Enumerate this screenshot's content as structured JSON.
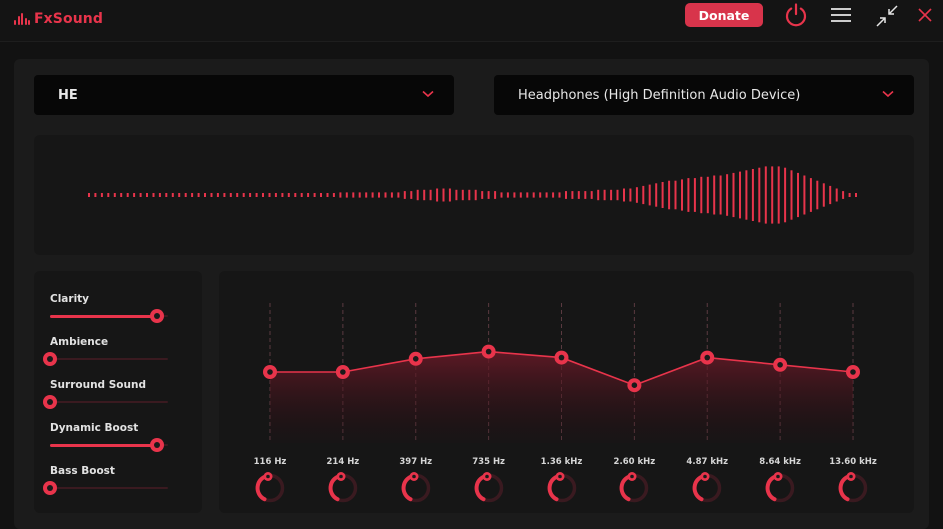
{
  "app": {
    "name": "FxSound",
    "donate_label": "Donate",
    "accent": "#e8344b"
  },
  "titlebar": {
    "icons": [
      "power-icon",
      "menu-icon",
      "minimize-arrows-icon",
      "close-icon"
    ]
  },
  "preset": {
    "selected": "HE"
  },
  "device": {
    "selected": "Headphones (High Definition Audio Device)"
  },
  "visualizer": {
    "bars": [
      1,
      1,
      1,
      1,
      1,
      1,
      1,
      1,
      1,
      1,
      1,
      1,
      1,
      1,
      1,
      1,
      1,
      1,
      1,
      1,
      1,
      1,
      1,
      1,
      1,
      1,
      1,
      1,
      1,
      1,
      1,
      1,
      1,
      1,
      1,
      1,
      1,
      1,
      1,
      1,
      1,
      1,
      1,
      1,
      1,
      1,
      1,
      1,
      1,
      1,
      1,
      1,
      1,
      1,
      1,
      1,
      1,
      1,
      1,
      1,
      1,
      1,
      1,
      1,
      1,
      1,
      1,
      1,
      1,
      1,
      1,
      1,
      1,
      1,
      1,
      1,
      1,
      1,
      2,
      2,
      2,
      2,
      2,
      2,
      2,
      2,
      2,
      2,
      2,
      2,
      2,
      2,
      2,
      2,
      2,
      2,
      2,
      3,
      3,
      3,
      3,
      4,
      4,
      4,
      4,
      4,
      4,
      4,
      5,
      5,
      5,
      5,
      5,
      5,
      4,
      4,
      4,
      4,
      4,
      4,
      4,
      3,
      3,
      3,
      3,
      3,
      3,
      3,
      2,
      2,
      2,
      2,
      2,
      2,
      2,
      2,
      2,
      2,
      2,
      2,
      2,
      2,
      2,
      2,
      2,
      2,
      2,
      2,
      3,
      3,
      3,
      3,
      3,
      3,
      3,
      3,
      3,
      3,
      4,
      4,
      4,
      4,
      4,
      4,
      4,
      4,
      5,
      5,
      5,
      6,
      6,
      6,
      7,
      7,
      8,
      8,
      9,
      9,
      10,
      10,
      11,
      11,
      11,
      12,
      12,
      12,
      13,
      13,
      13,
      13,
      14,
      14,
      14,
      15,
      15,
      15,
      15,
      16,
      16,
      16,
      17,
      17,
      18,
      18,
      19,
      19,
      20,
      20,
      21,
      21,
      22,
      22,
      22,
      22,
      22,
      22,
      21,
      20,
      19,
      18,
      17,
      16,
      15,
      14,
      13,
      12,
      11,
      10,
      9,
      8,
      7,
      6,
      5,
      4,
      3,
      2,
      1,
      1,
      1,
      1
    ]
  },
  "effects": [
    {
      "label": "Clarity",
      "value": 1.0
    },
    {
      "label": "Ambience",
      "value": 0.0
    },
    {
      "label": "Surround Sound",
      "value": 0.0
    },
    {
      "label": "Dynamic Boost",
      "value": 1.0
    },
    {
      "label": "Bass Boost",
      "value": 0.0
    }
  ],
  "eq": {
    "bands": [
      {
        "freq": "116 Hz",
        "gain": 0.0
      },
      {
        "freq": "214 Hz",
        "gain": 0.0
      },
      {
        "freq": "397 Hz",
        "gain": 1.1
      },
      {
        "freq": "735 Hz",
        "gain": 1.7
      },
      {
        "freq": "1.36 kHz",
        "gain": 1.2
      },
      {
        "freq": "2.60 kHz",
        "gain": -1.1
      },
      {
        "freq": "4.87 kHz",
        "gain": 1.2
      },
      {
        "freq": "8.64 kHz",
        "gain": 0.6
      },
      {
        "freq": "13.60 kHz",
        "gain": 0.0
      }
    ],
    "gain_range": [
      -7,
      7
    ]
  }
}
